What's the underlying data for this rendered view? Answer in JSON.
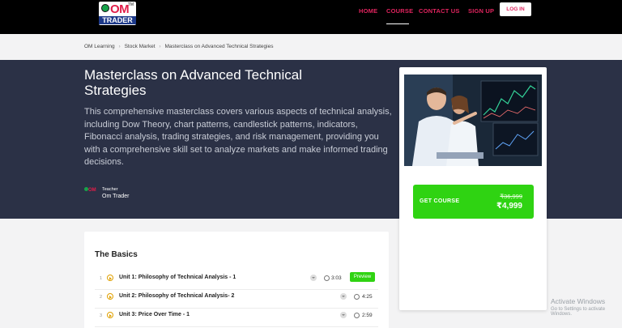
{
  "nav": {
    "logo_om": "OM",
    "logo_tm": "TM",
    "logo_trader": "TRADER",
    "links": [
      "HOME",
      "COURSE",
      "CONTACT US",
      "SIGN UP"
    ],
    "login_label": "LOG IN"
  },
  "breadcrumb": [
    "OM Learning",
    "Stock Market",
    "Masterclass on Advanced Technical Strategies"
  ],
  "course": {
    "title": "Masterclass on Advanced Technical Strategies",
    "description": "This comprehensive masterclass covers various aspects of technical analysis, including Dow Theory, chart patterns, candlestick patterns, indicators, Fibonacci analysis, trading strategies, and risk management, providing you with a comprehensive skill set to analyze markets and make informed trading decisions.",
    "teacher_label": "Teacher",
    "teacher_name": "Om Trader",
    "teacher_avatar_text": "OM"
  },
  "card": {
    "cta_label": "GET COURSE",
    "price_old": "₹36,999",
    "price_new": "₹4,999"
  },
  "basics": {
    "title": "The Basics",
    "units": [
      {
        "num": "1",
        "title": "Unit 1: Philosophy of Technical Analysis - 1",
        "duration": "3:03",
        "preview": "Preview"
      },
      {
        "num": "2",
        "title": "Unit 2: Philosophy of Technical Analysis- 2",
        "duration": "4:25"
      },
      {
        "num": "3",
        "title": "Unit 3: Price Over Time - 1",
        "duration": "2:59"
      }
    ]
  },
  "watermark": {
    "line1": "Activate Windows",
    "line2": "Go to Settings to activate Windows."
  },
  "colors": {
    "accent": "#e0245e",
    "hero_bg": "#2b3146",
    "cta_green": "#2fd312"
  }
}
